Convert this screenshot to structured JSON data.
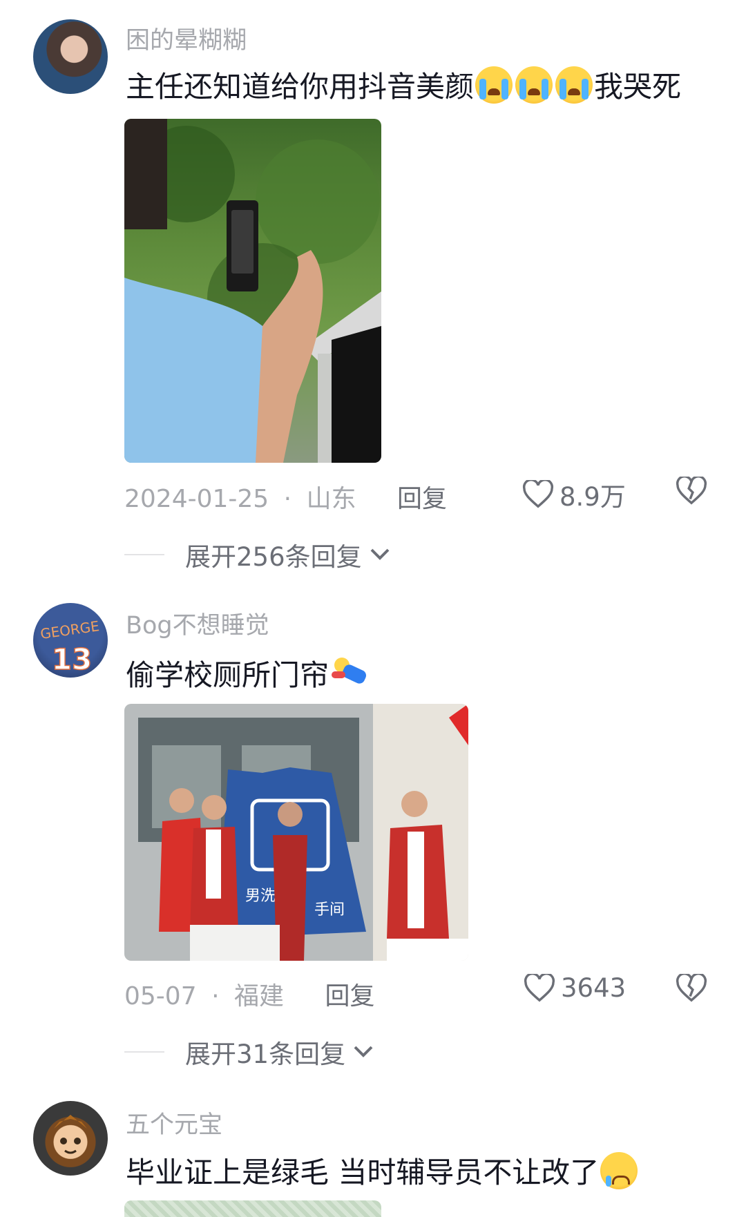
{
  "comments": [
    {
      "username": "困的晕糊糊",
      "text_main": "主任还知道给你用抖音美颜",
      "text_tail": "我哭死",
      "date": "2024-01-25",
      "location": "山东",
      "reply_label": "回复",
      "likes": "8.9万",
      "expand_label": "展开256条回复"
    },
    {
      "username": "Bog不想睡觉",
      "text_main": "偷学校厕所门帘",
      "date": "05-07",
      "location": "福建",
      "reply_label": "回复",
      "likes": "3643",
      "expand_label": "展开31条回复",
      "jersey_text": "GEORGE",
      "jersey_number": "13",
      "sign_text_left": "男洗",
      "sign_text_right": "手间"
    },
    {
      "username": "五个元宝",
      "text_main": "毕业证上是绿毛 当时辅导员不让改了"
    }
  ],
  "separator": "·",
  "colors": {
    "secondary_text": "#a6a8ad",
    "action_text": "#6b6e76",
    "main_text": "#161823"
  },
  "icons": {
    "like": "heart-outline-icon",
    "dislike": "broken-heart-icon",
    "expand": "chevron-down-icon"
  }
}
